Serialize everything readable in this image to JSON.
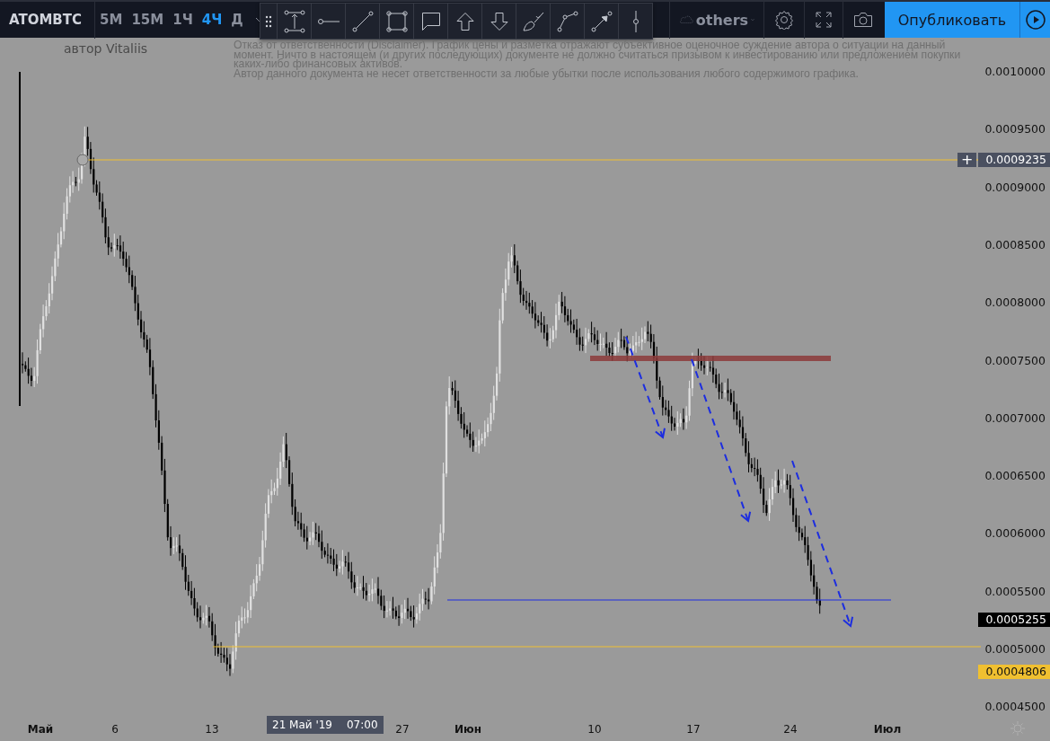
{
  "toolbar": {
    "symbol": "ATOMBTC",
    "intervals": [
      {
        "label": "5M",
        "selected": false
      },
      {
        "label": "15M",
        "selected": false
      },
      {
        "label": "1Ч",
        "selected": false
      },
      {
        "label": "4Ч",
        "selected": true
      },
      {
        "label": "Д",
        "selected": false
      }
    ],
    "layout_name": "others",
    "publish_button": "Опубликовать"
  },
  "chart": {
    "author": "автор Vitaliis",
    "disclaimer": [
      "Отказ от ответственности (Disclaimer). График цены и разметка отражают субъективное оценочное суждение автора о ситуации на данный момент. Ничто в настоящем (и других последующих) документе не должно считаться призывом к инвестированию или предложением покупки каких-либо финансовых активов.",
      "Автор данного документа не несет ответственности за любые убытки после использования любого содержимого графика."
    ],
    "price_ticks": [
      "0.0010000",
      "0.0009500",
      "0.0009000",
      "0.0008500",
      "0.0008000",
      "0.0007500",
      "0.0007000",
      "0.0006500",
      "0.0006000",
      "0.0005500",
      "0.0005000",
      "0.0004500"
    ],
    "price_badges": [
      {
        "value": "0.0009235",
        "kind": "alert",
        "action": "+"
      },
      {
        "value": "0.0005255",
        "kind": "last"
      },
      {
        "value": "0.0004806",
        "kind": "line"
      }
    ],
    "time_ticks": [
      {
        "label": "Май",
        "kind": "month"
      },
      {
        "label": "6",
        "kind": "day"
      },
      {
        "label": "13",
        "kind": "day"
      },
      {
        "label": "27",
        "kind": "day"
      },
      {
        "label": "Июн",
        "kind": "month"
      },
      {
        "label": "10",
        "kind": "day"
      },
      {
        "label": "17",
        "kind": "day"
      },
      {
        "label": "24",
        "kind": "day"
      },
      {
        "label": "Июл",
        "kind": "month"
      }
    ],
    "crosshair": {
      "date": "21 Май '19",
      "time": "07:00"
    }
  }
}
